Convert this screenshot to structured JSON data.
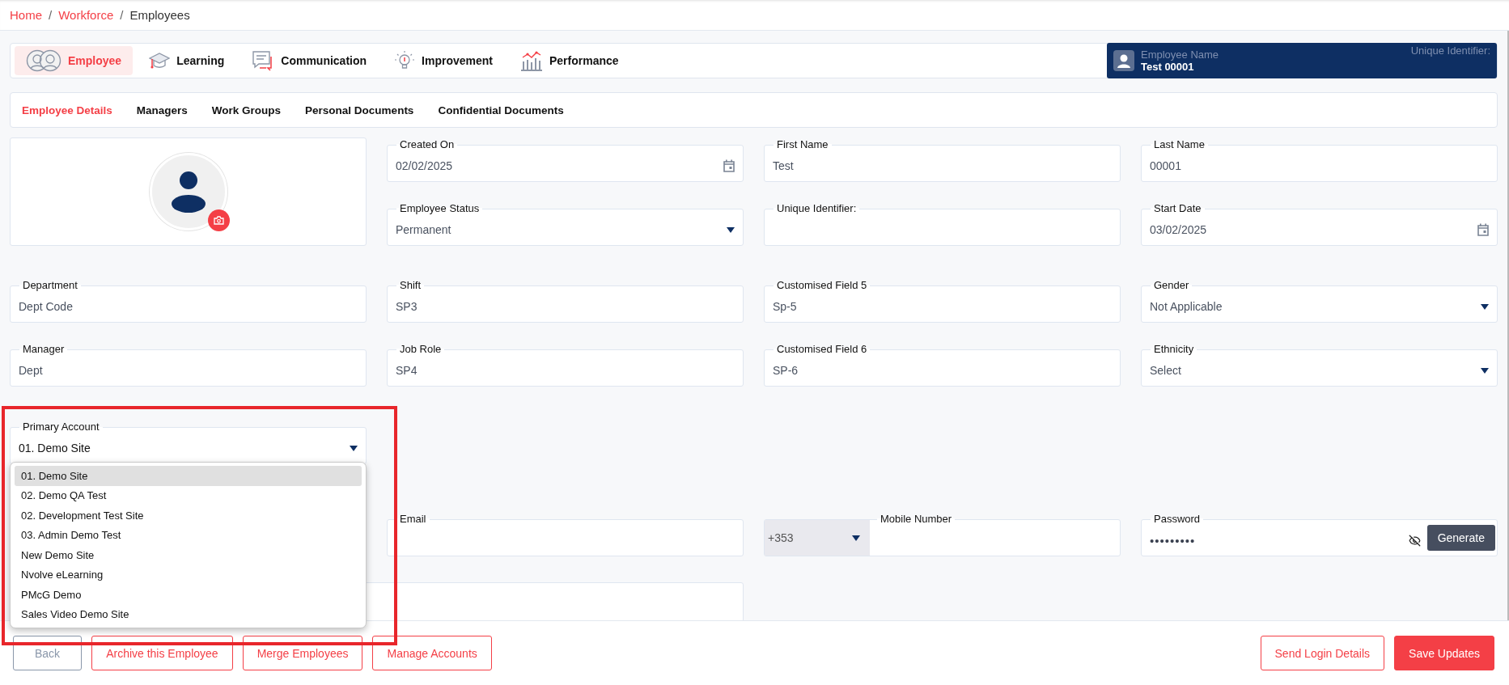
{
  "breadcrumb": [
    {
      "label": "Home",
      "current": false
    },
    {
      "label": "Workforce",
      "current": false
    },
    {
      "label": "Employees",
      "current": true
    }
  ],
  "breadcrumb_separators": [
    "/",
    "/"
  ],
  "modules": [
    {
      "label": "Employee",
      "selected": true
    },
    {
      "label": "Learning",
      "selected": false
    },
    {
      "label": "Communication",
      "selected": false
    },
    {
      "label": "Improvement",
      "selected": false
    },
    {
      "label": "Performance",
      "selected": false
    }
  ],
  "employee_card": {
    "caption": "Employee Name",
    "name": "Test 00001",
    "identifier_caption": "Unique Identifier:"
  },
  "sub_tabs": [
    {
      "label": "Employee Details",
      "selected": true
    },
    {
      "label": "Managers",
      "selected": false
    },
    {
      "label": "Work Groups",
      "selected": false
    },
    {
      "label": "Personal Documents",
      "selected": false
    },
    {
      "label": "Confidential Documents",
      "selected": false
    }
  ],
  "top_fields": [
    {
      "kind": "date",
      "label": "Created On",
      "value": "02/02/2025"
    },
    {
      "kind": "text",
      "label": "First Name",
      "value": "Test"
    },
    {
      "kind": "text",
      "label": "Last Name",
      "value": "00001"
    },
    {
      "kind": "select",
      "label": "Employee Status",
      "value": "Permanent"
    },
    {
      "kind": "text",
      "label": "Unique Identifier:"
    },
    {
      "kind": "date",
      "label": "Start Date",
      "value": "03/02/2025"
    }
  ],
  "middle_fields": [
    {
      "kind": "text",
      "label": "Department",
      "value": "Dept Code"
    },
    {
      "kind": "text",
      "label": "Shift",
      "value": "SP3"
    },
    {
      "kind": "text",
      "label": "Customised Field 5",
      "value": "Sp-5"
    },
    {
      "kind": "select",
      "label": "Gender",
      "value": "Not Applicable"
    },
    {
      "kind": "text",
      "label": "Manager",
      "value": "Dept"
    },
    {
      "kind": "text",
      "label": "Job Role",
      "value": "SP4"
    },
    {
      "kind": "text",
      "label": "Customised Field 6",
      "value": "SP-6"
    },
    {
      "kind": "select",
      "label": "Ethnicity",
      "value": "Select"
    }
  ],
  "primary_account": {
    "label": "Primary Account",
    "value": "01. Demo Site",
    "options": [
      {
        "label": "01. Demo Site",
        "selected": true
      },
      {
        "label": "02. Demo QA Test",
        "selected": false
      },
      {
        "label": "02. Development Test Site",
        "selected": false
      },
      {
        "label": "03. Admin Demo Test",
        "selected": false
      },
      {
        "label": "New Demo Site",
        "selected": false
      },
      {
        "label": "Nvolve eLearning",
        "selected": false
      },
      {
        "label": "PMcG Demo",
        "selected": false
      },
      {
        "label": "Sales Video Demo Site",
        "selected": false
      }
    ]
  },
  "contact_fields": [
    {
      "kind": "text",
      "label": "Email"
    },
    {
      "kind": "phone",
      "label": "Mobile Number",
      "country_code": "+353"
    },
    {
      "kind": "password",
      "label": "Password",
      "value": "•••••••••",
      "button": "Generate"
    }
  ],
  "actions_left": [
    {
      "label": "Back",
      "disabled": true
    },
    {
      "label": "Archive this Employee",
      "disabled": false
    },
    {
      "label": "Merge Employees",
      "disabled": false
    },
    {
      "label": "Manage Accounts",
      "disabled": false
    }
  ],
  "actions_right": [
    {
      "label": "Send Login Details",
      "kind": "outline"
    },
    {
      "label": "Save Updates",
      "kind": "filled"
    }
  ]
}
